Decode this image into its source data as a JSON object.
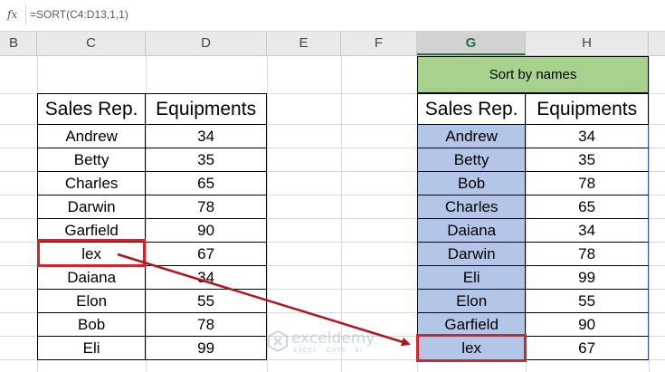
{
  "formula_bar": {
    "fx_label": "fx",
    "formula": "=SORT(C4:D13,1,1)"
  },
  "columns": [
    "B",
    "C",
    "D",
    "E",
    "F",
    "G",
    "H"
  ],
  "selected_column": "G",
  "left_table": {
    "headers": [
      "Sales Rep.",
      "Equipments"
    ],
    "rows": [
      [
        "Andrew",
        "34"
      ],
      [
        "Betty",
        "35"
      ],
      [
        "Charles",
        "65"
      ],
      [
        "Darwin",
        "78"
      ],
      [
        "Garfield",
        "90"
      ],
      [
        "lex",
        "67"
      ],
      [
        "Daiana",
        "34"
      ],
      [
        "Elon",
        "55"
      ],
      [
        "Bob",
        "78"
      ],
      [
        "Eli",
        "99"
      ]
    ]
  },
  "right_table": {
    "banner": "Sort by names",
    "headers": [
      "Sales Rep.",
      "Equipments"
    ],
    "rows": [
      [
        "Andrew",
        "34"
      ],
      [
        "Betty",
        "35"
      ],
      [
        "Bob",
        "78"
      ],
      [
        "Charles",
        "65"
      ],
      [
        "Daiana",
        "34"
      ],
      [
        "Darwin",
        "78"
      ],
      [
        "Eli",
        "99"
      ],
      [
        "Elon",
        "55"
      ],
      [
        "Garfield",
        "90"
      ],
      [
        "lex",
        "67"
      ]
    ]
  },
  "watermark": {
    "name": "exceldemy",
    "tagline": "EXCEL · DATA · BI"
  },
  "colors": {
    "highlight_fill": "#b4c6e7",
    "banner_fill": "#a9d18e",
    "annotation_red": "#d0252c"
  }
}
